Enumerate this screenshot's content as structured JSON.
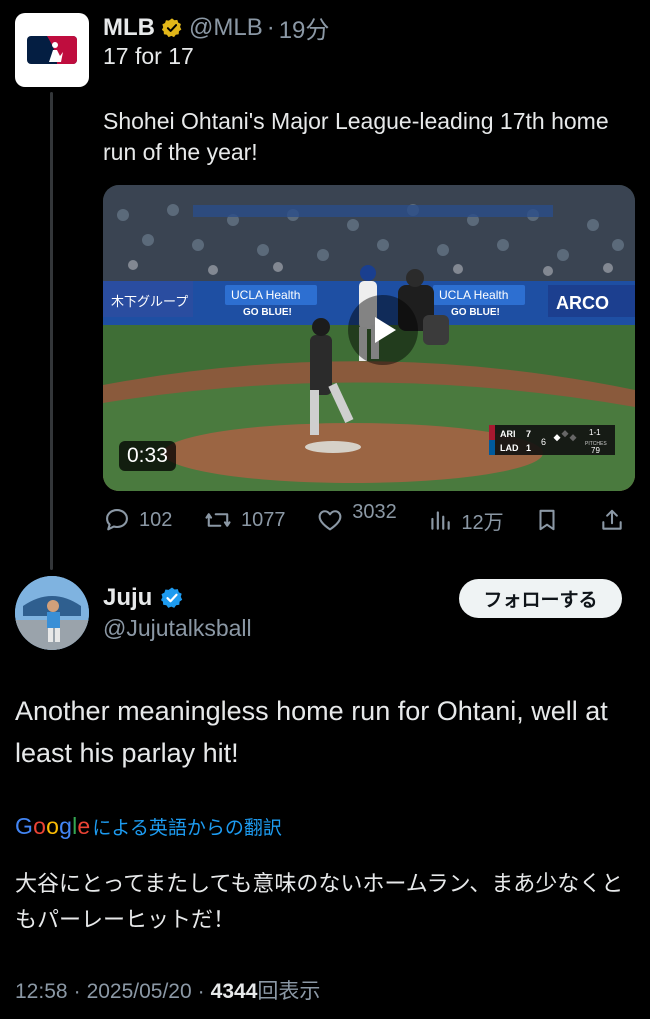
{
  "parent_tweet": {
    "author_name": "MLB",
    "handle": "@MLB",
    "separator": "·",
    "time": "19分",
    "line1": "17 for 17",
    "body": "Shohei Ohtani's Major League-leading 17th home run of the year!",
    "video": {
      "duration": "0:33",
      "banner_left": "木下グループ",
      "banner_ucla1": "UCLA Health",
      "banner_ucla1_sub": "GO BLUE!",
      "banner_ucla2": "UCLA Health",
      "banner_ucla2_sub": "GO BLUE!",
      "banner_right": "ARCO",
      "score": {
        "away_team": "ARI",
        "away_score": "7",
        "home_team": "LAD",
        "home_score": "1",
        "inning": "6",
        "count": "1-1",
        "pitches_label": "PITCHES",
        "pitches": "79"
      }
    },
    "actions": {
      "replies": "102",
      "reposts": "1077",
      "likes": "3032",
      "views": "12万"
    }
  },
  "reply_tweet": {
    "author_name": "Juju",
    "handle": "@Jujutalksball",
    "follow_label": "フォローする",
    "text": "Another meaningless home run for Ohtani, well at least his parlay hit!",
    "translate_brand": "Google",
    "translate_label": "による英語からの翻訳",
    "translated_text": "大谷にとってまたしても意味のないホームラン、まあ少なくともパーレーヒットだ！",
    "meta": {
      "time": "12:58",
      "sep1": "·",
      "date": "2025/05/20",
      "sep2": "·",
      "views_count": "4344",
      "views_label": "回表示"
    }
  },
  "colors": {
    "background": "#000000",
    "text": "#e7e9ea",
    "muted": "#8b98a5",
    "link": "#1d9bf0",
    "verified_gold": "#e2b719",
    "verified_blue": "#1d9bf0",
    "follow_bg": "#eff3f4"
  },
  "icons": [
    "mlb-logo",
    "verified-gold-icon",
    "play-icon",
    "reply-icon",
    "repost-icon",
    "like-icon",
    "views-icon",
    "bookmark-icon",
    "share-icon",
    "verified-blue-icon",
    "google-logo"
  ]
}
